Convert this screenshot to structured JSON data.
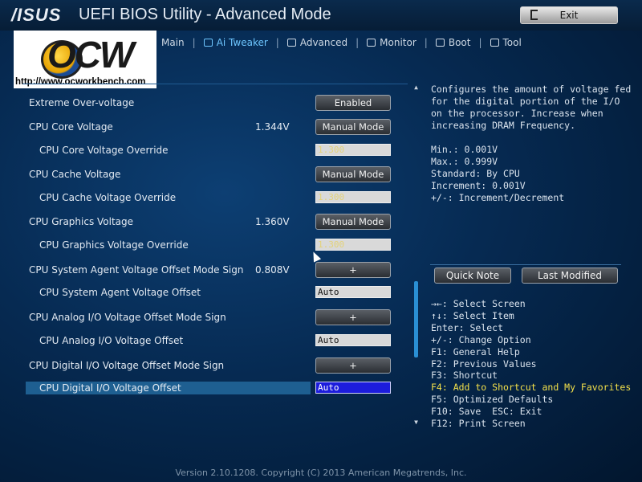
{
  "header": {
    "brand": "/ISUS",
    "title": "UEFI BIOS Utility - Advanced Mode",
    "exit_label": "Exit"
  },
  "logo": {
    "text": "OCW",
    "url": "http://www.ocworkbench.com"
  },
  "tabs": [
    {
      "label": "Main",
      "icon": "main-icon",
      "active": false
    },
    {
      "label": "Ai Tweaker",
      "icon": "tweaker-icon",
      "active": true
    },
    {
      "label": "Advanced",
      "icon": "advanced-icon",
      "active": false
    },
    {
      "label": "Monitor",
      "icon": "monitor-icon",
      "active": false
    },
    {
      "label": "Boot",
      "icon": "power-icon",
      "active": false
    },
    {
      "label": "Tool",
      "icon": "tool-icon",
      "active": false
    }
  ],
  "settings": [
    {
      "label": "Extreme Over-voltage",
      "value": "",
      "control": "button",
      "control_value": "Enabled",
      "indent": false
    },
    {
      "label": "CPU Core Voltage",
      "value": "1.344V",
      "control": "button",
      "control_value": "Manual Mode",
      "indent": false
    },
    {
      "label": "CPU Core Voltage Override",
      "value": "",
      "control": "field",
      "control_value": "1.300",
      "indent": true
    },
    {
      "label": "CPU Cache Voltage",
      "value": "",
      "control": "button",
      "control_value": "Manual Mode",
      "indent": false
    },
    {
      "label": "CPU Cache Voltage Override",
      "value": "",
      "control": "field",
      "control_value": "1.300",
      "indent": true
    },
    {
      "label": "CPU Graphics Voltage",
      "value": "1.360V",
      "control": "button",
      "control_value": "Manual Mode",
      "indent": false
    },
    {
      "label": "CPU Graphics Voltage Override",
      "value": "",
      "control": "field",
      "control_value": "1.300",
      "indent": true
    },
    {
      "label": "CPU System Agent Voltage Offset Mode Sign",
      "value": "0.808V",
      "control": "button",
      "control_value": "+",
      "indent": false
    },
    {
      "label": "CPU System Agent Voltage Offset",
      "value": "",
      "control": "field",
      "control_value": "Auto",
      "indent": true
    },
    {
      "label": "CPU Analog I/O Voltage Offset Mode Sign",
      "value": "",
      "control": "button",
      "control_value": "+",
      "indent": false
    },
    {
      "label": "CPU Analog I/O Voltage Offset",
      "value": "",
      "control": "field",
      "control_value": "Auto",
      "indent": true
    },
    {
      "label": "CPU Digital I/O Voltage Offset Mode Sign",
      "value": "",
      "control": "button",
      "control_value": "+",
      "indent": false
    },
    {
      "label": "CPU Digital I/O Voltage Offset",
      "value": "",
      "control": "field",
      "control_value": "Auto",
      "indent": true,
      "selected": true
    }
  ],
  "help": {
    "description": "Configures the amount of voltage fed for the digital portion of the I/O on the processor. Increase when increasing DRAM Frequency.",
    "info": [
      "Min.: 0.001V",
      "Max.: 0.999V",
      "Standard: By CPU",
      "Increment: 0.001V",
      "+/-: Increment/Decrement"
    ]
  },
  "right_buttons": {
    "quick_note": "Quick Note",
    "last_modified": "Last Modified"
  },
  "keys": [
    {
      "text": "→←: Select Screen",
      "highlight": false
    },
    {
      "text": "↑↓: Select Item",
      "highlight": false
    },
    {
      "text": "Enter: Select",
      "highlight": false
    },
    {
      "text": "+/-: Change Option",
      "highlight": false
    },
    {
      "text": "F1: General Help",
      "highlight": false
    },
    {
      "text": "F2: Previous Values",
      "highlight": false
    },
    {
      "text": "F3: Shortcut",
      "highlight": false
    },
    {
      "text": "F4: Add to Shortcut and My Favorites",
      "highlight": true
    },
    {
      "text": "F5: Optimized Defaults",
      "highlight": false
    },
    {
      "text": "F10: Save  ESC: Exit",
      "highlight": false
    },
    {
      "text": "F12: Print Screen",
      "highlight": false
    }
  ],
  "footer": "Version 2.10.1208. Copyright (C) 2013 American Megatrends, Inc.",
  "colors": {
    "background": "#062a52",
    "accent": "#6ec6ff",
    "selection_field": "#1c1cdc",
    "highlight_text": "#f3e04a"
  }
}
